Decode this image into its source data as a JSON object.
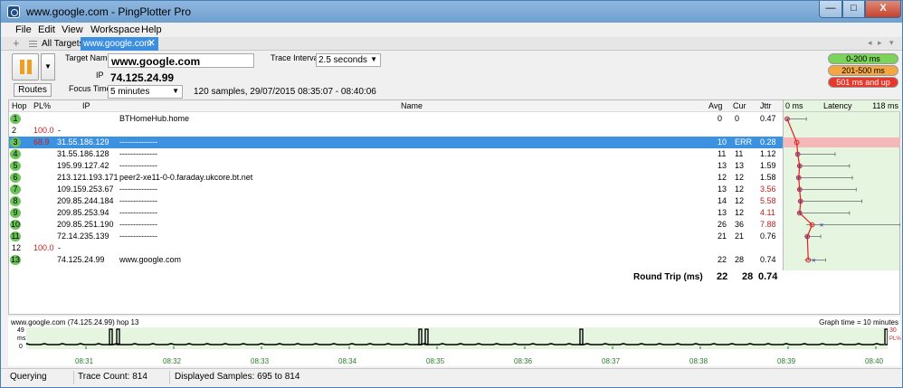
{
  "window": {
    "title": "www.google.com - PingPlotter Pro",
    "min": "—",
    "max": "□",
    "close": "X"
  },
  "menu": [
    "File",
    "Edit",
    "View",
    "Workspace",
    "Help"
  ],
  "tabs": {
    "all_targets": "All Targets",
    "active": "www.google.com",
    "close": "✕",
    "nav_left": "◂",
    "nav_right": "▸",
    "nav_more": "▾"
  },
  "controls": {
    "target_name_label": "Target Name",
    "target_name": "www.google.com",
    "ip_label": "IP",
    "ip": "74.125.24.99",
    "trace_interval_label": "Trace Interval",
    "trace_interval": "2.5 seconds",
    "focus_time_label": "Focus Time",
    "focus_time": "5 minutes",
    "routes_button": "Routes",
    "samples_info": "120 samples, 29/07/2015 08:35:07 - 08:40:06",
    "legend": [
      {
        "label": "0-200 ms",
        "color": "#7bd35a"
      },
      {
        "label": "201-500 ms",
        "color": "#f4a640"
      },
      {
        "label": "501 ms and up",
        "color": "#e8382c"
      }
    ]
  },
  "table": {
    "headers": {
      "hop": "Hop",
      "pl": "PL%",
      "ip": "IP",
      "name": "Name",
      "avg": "Avg",
      "cur": "Cur",
      "jttr": "Jttr",
      "latency": "Latency",
      "lat_min": "0 ms",
      "lat_max": "118 ms"
    },
    "rows": [
      {
        "hop": "1",
        "pl": "",
        "ip": "",
        "name": "BTHomeHub.home",
        "avg": "0",
        "cur": "0",
        "jttr": "0.47",
        "badge": true,
        "jttr_red": false,
        "avg_ms": 0,
        "min_ms": 0,
        "max_ms": 20
      },
      {
        "hop": "2",
        "pl": "100.0",
        "ip": "-",
        "name": "",
        "avg": "",
        "cur": "",
        "jttr": "",
        "badge": false,
        "jttr_red": false
      },
      {
        "hop": "3",
        "pl": "68.9",
        "ip": "31.55.186.129",
        "name": "--------------",
        "avg": "10",
        "cur": "ERR",
        "jttr": "0.28",
        "badge": true,
        "jttr_red": false,
        "selected": true,
        "avg_ms": 10
      },
      {
        "hop": "4",
        "pl": "",
        "ip": "31.55.186.128",
        "name": "--------------",
        "avg": "11",
        "cur": "11",
        "jttr": "1.12",
        "badge": true,
        "jttr_red": false,
        "avg_ms": 11,
        "min_ms": 10,
        "max_ms": 50
      },
      {
        "hop": "5",
        "pl": "",
        "ip": "195.99.127.42",
        "name": "--------------",
        "avg": "13",
        "cur": "13",
        "jttr": "1.59",
        "badge": true,
        "jttr_red": false,
        "avg_ms": 13,
        "min_ms": 11,
        "max_ms": 65
      },
      {
        "hop": "6",
        "pl": "",
        "ip": "213.121.193.171",
        "name": "peer2-xe11-0-0.faraday.ukcore.bt.net",
        "avg": "12",
        "cur": "12",
        "jttr": "1.58",
        "badge": true,
        "jttr_red": false,
        "avg_ms": 12,
        "min_ms": 10,
        "max_ms": 68
      },
      {
        "hop": "7",
        "pl": "",
        "ip": "109.159.253.67",
        "name": "--------------",
        "avg": "13",
        "cur": "12",
        "jttr": "3.56",
        "badge": true,
        "jttr_red": true,
        "avg_ms": 13,
        "min_ms": 11,
        "max_ms": 72
      },
      {
        "hop": "8",
        "pl": "",
        "ip": "209.85.244.184",
        "name": "--------------",
        "avg": "14",
        "cur": "12",
        "jttr": "5.58",
        "badge": true,
        "jttr_red": true,
        "avg_ms": 14,
        "min_ms": 11,
        "max_ms": 78
      },
      {
        "hop": "9",
        "pl": "",
        "ip": "209.85.253.94",
        "name": "--------------",
        "avg": "13",
        "cur": "12",
        "jttr": "4.11",
        "badge": true,
        "jttr_red": true,
        "avg_ms": 13,
        "min_ms": 11,
        "max_ms": 65
      },
      {
        "hop": "10",
        "pl": "",
        "ip": "209.85.251.190",
        "name": "--------------",
        "avg": "26",
        "cur": "36",
        "jttr": "7.88",
        "badge": true,
        "jttr_red": true,
        "avg_ms": 26,
        "min_ms": 20,
        "max_ms": 118,
        "cur_ms": 36
      },
      {
        "hop": "11",
        "pl": "",
        "ip": "72.14.235.139",
        "name": "--------------",
        "avg": "21",
        "cur": "21",
        "jttr": "0.76",
        "badge": true,
        "jttr_red": false,
        "avg_ms": 21,
        "min_ms": 18,
        "max_ms": 35
      },
      {
        "hop": "12",
        "pl": "100.0",
        "ip": "-",
        "name": "",
        "avg": "",
        "cur": "",
        "jttr": "",
        "badge": false,
        "jttr_red": false
      },
      {
        "hop": "13",
        "pl": "",
        "ip": "74.125.24.99",
        "name": "www.google.com",
        "avg": "22",
        "cur": "28",
        "jttr": "0.74",
        "badge": true,
        "jttr_red": false,
        "avg_ms": 22,
        "min_ms": 18,
        "max_ms": 40,
        "cur_ms": 28
      }
    ],
    "round_trip": {
      "label": "Round Trip (ms)",
      "avg": "22",
      "cur": "28",
      "jttr": "0.74"
    }
  },
  "graph": {
    "title": "www.google.com (74.125.24.99) hop 13",
    "graph_time": "Graph time = 10 minutes",
    "y_max": "49",
    "y_unit": "ms",
    "y_min": "0",
    "pl_max": "30",
    "pl_unit": "PL%",
    "times": [
      "08:31",
      "08:32",
      "08:33",
      "08:34",
      "08:35",
      "08:36",
      "08:37",
      "08:38",
      "08:39",
      "08:40"
    ]
  },
  "status": {
    "state": "Querying",
    "trace_count": "Trace Count: 814",
    "displayed": "Displayed Samples: 695 to 814"
  }
}
